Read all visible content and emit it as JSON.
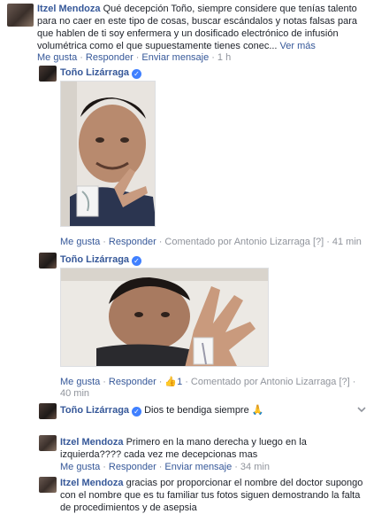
{
  "comments": [
    {
      "name": "Itzel Mendoza",
      "line1": "Qué decepción Toño, siempre considere que tenías talento",
      "line2": "para no caer en este tipo de cosas, buscar escándalos y notas falsas para",
      "line3": "que hablen de ti soy enfermera y un dosificado electrónico de infusión",
      "line4": "volumétrica como el que supuestamente tienes conec...",
      "see_more": "Ver más",
      "like": "Me gusta",
      "reply": "Responder",
      "send": "Enviar mensaje",
      "time": "1 h"
    },
    {
      "name": "Toño Lizárraga",
      "like": "Me gusta",
      "reply": "Responder",
      "by": "Comentado por Antonio Lizarraga",
      "q": "[?]",
      "time": "41 min"
    },
    {
      "name": "Toño Lizárraga",
      "like": "Me gusta",
      "reply": "Responder",
      "likes_count": "1",
      "by": "Comentado por Antonio Lizarraga",
      "q": "[?]",
      "time": "40 min"
    },
    {
      "name": "Toño Lizárraga",
      "text": "Dios te bendiga siempre"
    },
    {
      "name": "Itzel Mendoza",
      "line1": "Primero en la mano derecha y luego en la",
      "line2": "izquierda???? cada vez me decepcionas mas",
      "like": "Me gusta",
      "reply": "Responder",
      "send": "Enviar mensaje",
      "time": "34 min"
    },
    {
      "name": "Itzel Mendoza",
      "line1": "gracias por proporcionar el nombre del doctor supongo",
      "line2": "con el nombre que es tu familiar tus fotos siguen demostrando la falta",
      "line3": "de procedimientos y de asepsia"
    }
  ],
  "colors": {
    "link": "#365899",
    "meta": "#90949c",
    "verified": "#4080ff"
  }
}
